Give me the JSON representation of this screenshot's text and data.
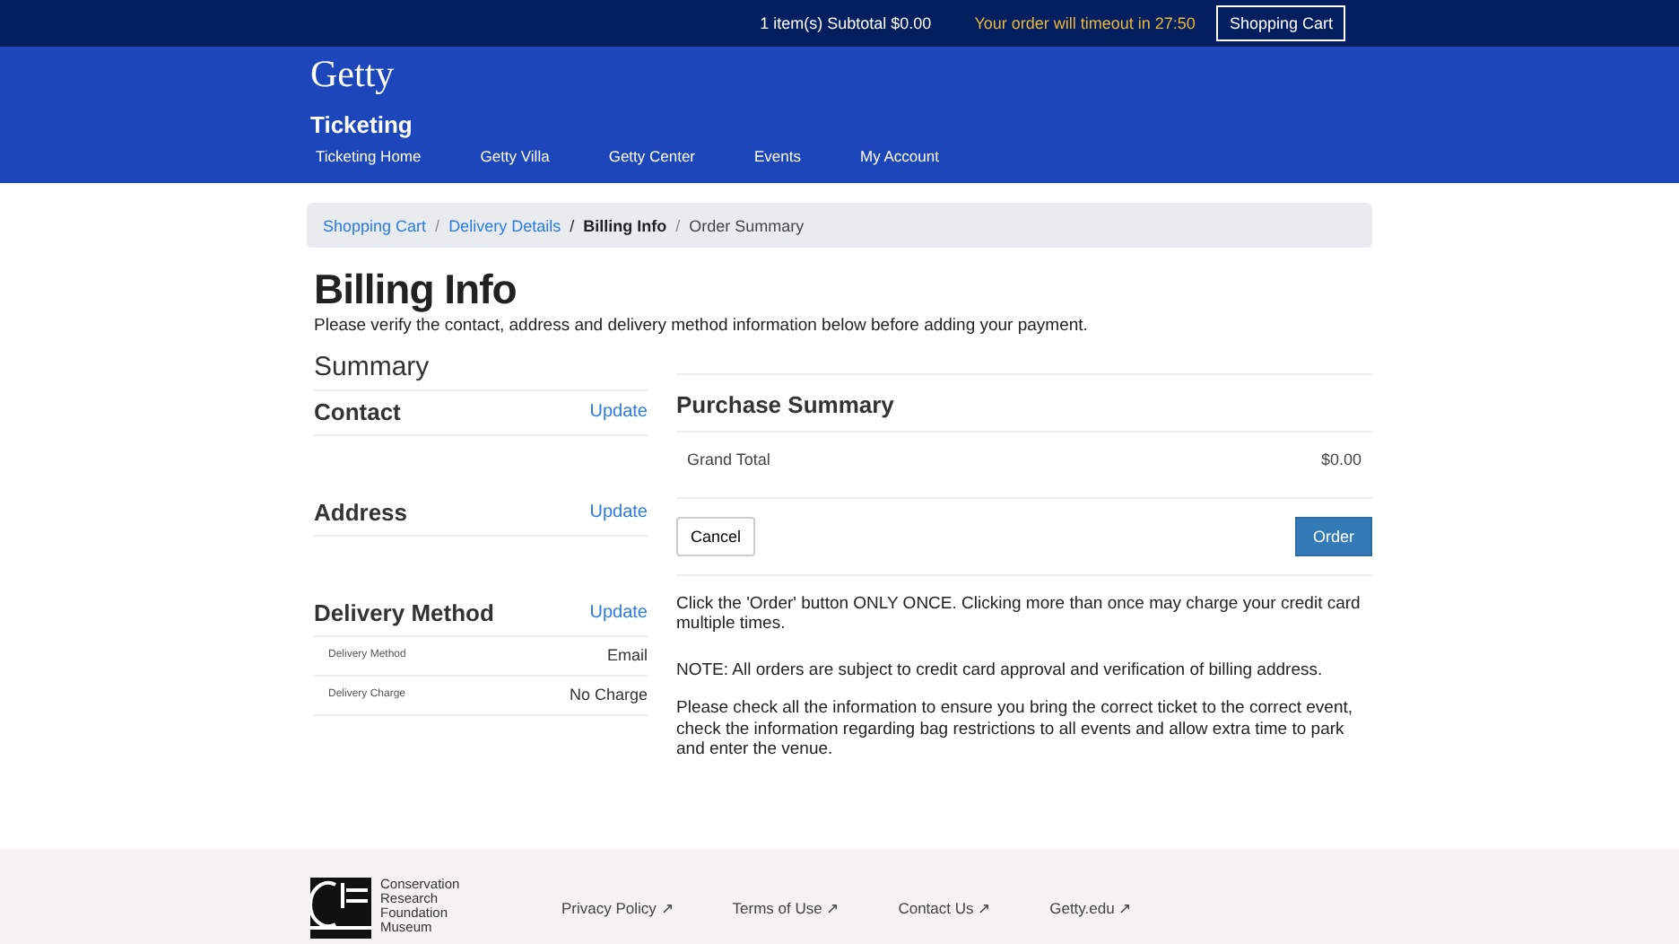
{
  "top_bar": {
    "cart_summary": "1 item(s) Subtotal $0.00",
    "timeout": "Your order will timeout in 27:50",
    "cart_button": "Shopping Cart"
  },
  "header": {
    "logo": "Getty",
    "title": "Ticketing",
    "nav": [
      "Ticketing Home",
      "Getty Villa",
      "Getty Center",
      "Events",
      "My Account"
    ]
  },
  "breadcrumb": [
    {
      "label": "Shopping Cart",
      "kind": "link"
    },
    {
      "separator": "/",
      "label": "Delivery Details",
      "kind": "link"
    },
    {
      "separator": "/",
      "label": "Billing Info",
      "kind": "current"
    },
    {
      "separator": "/",
      "label": "Order Summary",
      "kind": "plain"
    }
  ],
  "page": {
    "title": "Billing Info",
    "intro": "Please verify the contact, address and delivery method information below before adding your payment."
  },
  "summary": {
    "title": "Summary",
    "sections": [
      {
        "title": "Contact",
        "action": "Update"
      },
      {
        "title": "Address",
        "action": "Update"
      },
      {
        "title": "Delivery Method",
        "action": "Update",
        "rows": [
          {
            "label": "Delivery Method",
            "value": "Email"
          },
          {
            "label": "Delivery Charge",
            "value": "No Charge"
          }
        ]
      }
    ]
  },
  "purchase": {
    "title": "Purchase Summary",
    "total_label": "Grand Total",
    "total_value": "$0.00",
    "cancel": "Cancel",
    "order": "Order",
    "notes": [
      "Click the 'Order' button ONLY ONCE. Clicking more than once may charge your credit card multiple times.",
      "NOTE: All orders are subject to credit card approval and verification of billing address.",
      "Please check all the information to ensure you bring the correct ticket to the correct event, check the information regarding bag restrictions to all events and allow extra time to park and enter the venue."
    ]
  },
  "footer": {
    "logo_lines": [
      "Conservation",
      "Research",
      "Foundation",
      "Museum"
    ],
    "links": [
      "Privacy Policy ↗",
      "Terms of Use ↗",
      "Contact Us ↗",
      "Getty.edu ↗"
    ]
  }
}
